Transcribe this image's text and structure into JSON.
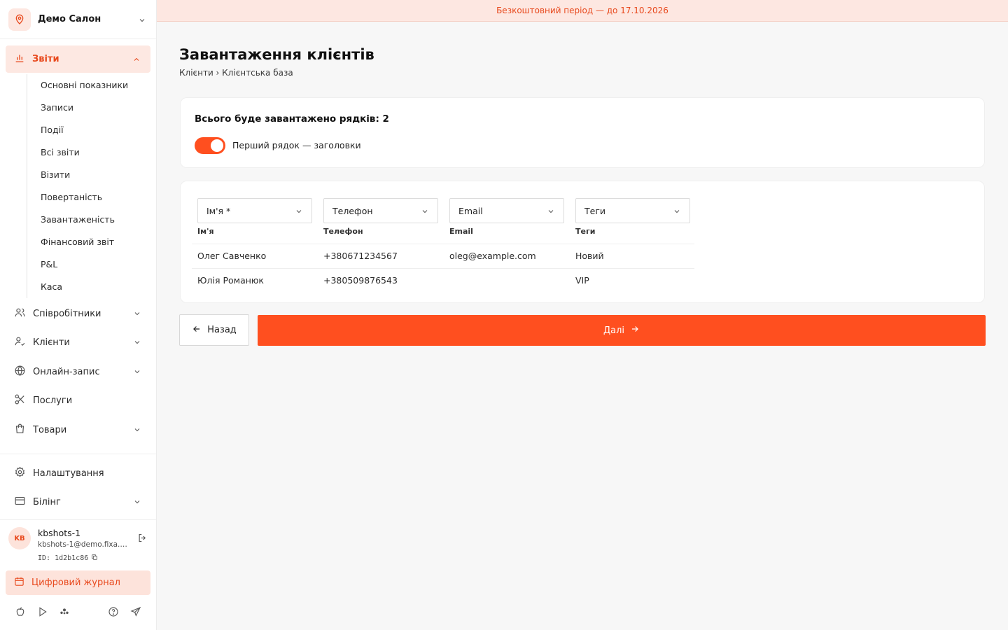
{
  "sidebar": {
    "salon_name": "Демо Салон",
    "reports_label": "Звіти",
    "report_items": [
      "Основні показники",
      "Записи",
      "Події",
      "Всі звіти",
      "Візити",
      "Повертаність",
      "Завантаженість",
      "Фінансовий звіт",
      "P&L",
      "Каса"
    ],
    "items": {
      "staff": "Співробітники",
      "clients": "Клієнти",
      "online": "Онлайн-запис",
      "services": "Послуги",
      "goods": "Товари",
      "settings": "Налаштування",
      "billing": "Білінг"
    },
    "user": {
      "initials": "KB",
      "name": "kbshots-1",
      "email": "kbshots-1@demo.fixa.b...",
      "id": "ID: 1d2b1c86"
    },
    "journal_label": "Цифровий журнал"
  },
  "banner": "Безкоштовний період — до 17.10.2026",
  "page": {
    "title": "Завантаження клієнтів",
    "breadcrumb": "Клієнти › Клієнтська база"
  },
  "summary": {
    "total_label": "Всього буде завантажено рядків: 2",
    "toggle_label": "Перший рядок — заголовки",
    "toggle_on": true
  },
  "mapping": {
    "selects": [
      "Ім'я *",
      "Телефон",
      "Email",
      "Теги"
    ],
    "headers": [
      "Ім'я",
      "Телефон",
      "Email",
      "Теги"
    ],
    "rows": [
      [
        "Олег Савченко",
        "+380671234567",
        "oleg@example.com",
        "Новий"
      ],
      [
        "Юлія Романюк",
        "+380509876543",
        "",
        "VIP"
      ]
    ]
  },
  "actions": {
    "back": "Назад",
    "next": "Далі"
  },
  "colors": {
    "accent": "#ff4f1f",
    "accent_text": "#e8491d",
    "accent_bg": "#fde7e1"
  }
}
